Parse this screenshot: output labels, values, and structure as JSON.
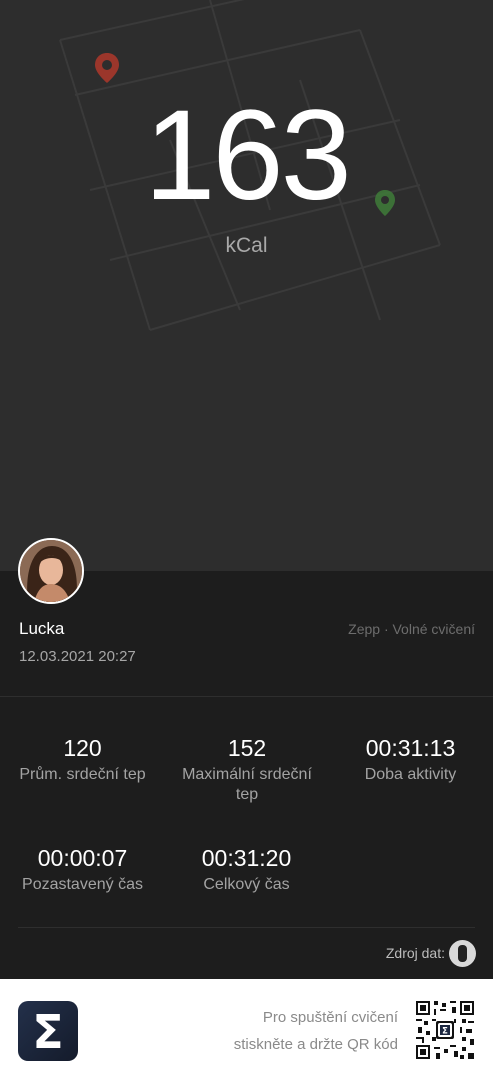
{
  "workout": {
    "calories_value": "163",
    "calories_unit": "kCal"
  },
  "user": {
    "name": "Lucka",
    "date": "12.03.2021 20:27",
    "source_app": "Zepp · Volné cvičení"
  },
  "stats": [
    {
      "value": "120",
      "label": "Prům. srdeční tep"
    },
    {
      "value": "152",
      "label": "Maximální srdeční tep"
    },
    {
      "value": "00:31:13",
      "label": "Doba aktivity"
    },
    {
      "value": "00:00:07",
      "label": "Pozastavený čas"
    },
    {
      "value": "00:31:20",
      "label": "Celkový čas"
    }
  ],
  "data_source": {
    "label": "Zdroj dat:",
    "icon": "watch-icon"
  },
  "footer": {
    "line1": "Pro spuštění cvičení",
    "line2": "stiskněte a držte QR kód",
    "logo_icon": "sigma-logo",
    "qr_icon": "qr-code"
  },
  "colors": {
    "map_background": "#2d2d2d",
    "card_background": "#1d1d1d",
    "start_pin": "#c0392b",
    "end_pin": "#3f7d3a"
  }
}
